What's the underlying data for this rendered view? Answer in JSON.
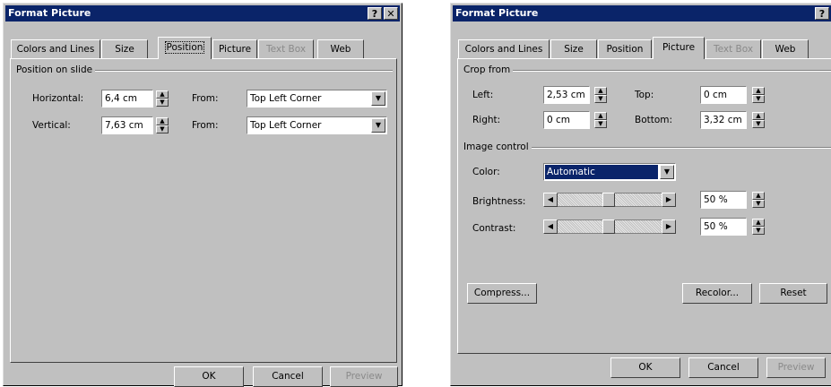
{
  "left_dialog": {
    "title": "Format Picture",
    "help_glyph": "?",
    "close_glyph": "✕",
    "tabs": [
      "Colors and Lines",
      "Size",
      "Position",
      "Picture",
      "Text Box",
      "Web"
    ],
    "active_tab": "Position",
    "group_position": "Position on slide",
    "horizontal_label": "Horizontal:",
    "horizontal_value": "6,4 cm",
    "vertical_label": "Vertical:",
    "vertical_value": "7,63 cm",
    "from_label": "From:",
    "from_horizontal_value": "Top Left Corner",
    "from_vertical_value": "Top Left Corner",
    "buttons": {
      "ok": "OK",
      "cancel": "Cancel",
      "preview": "Preview"
    }
  },
  "right_dialog": {
    "title": "Format Picture",
    "help_glyph": "?",
    "close_glyph": "✕",
    "tabs": [
      "Colors and Lines",
      "Size",
      "Position",
      "Picture",
      "Text Box",
      "Web"
    ],
    "active_tab": "Picture",
    "group_crop": "Crop from",
    "left_label": "Left:",
    "left_value": "2,53 cm",
    "right_label": "Right:",
    "right_value": "0 cm",
    "top_label": "Top:",
    "top_value": "0 cm",
    "bottom_label": "Bottom:",
    "bottom_value": "3,32 cm",
    "group_image_control": "Image control",
    "color_label": "Color:",
    "color_value": "Automatic",
    "brightness_label": "Brightness:",
    "brightness_value": "50 %",
    "brightness_level": 0.5,
    "contrast_label": "Contrast:",
    "contrast_value": "50 %",
    "contrast_level": 0.5,
    "buttons": {
      "compress": "Compress...",
      "recolor": "Recolor...",
      "reset": "Reset",
      "ok": "OK",
      "cancel": "Cancel",
      "preview": "Preview"
    }
  },
  "colors": {
    "titlebar": "#0a2469",
    "dialog_bg": "#c0c0c0",
    "selection": "#0a246a"
  },
  "icons": {
    "spin_up": "▲",
    "spin_down": "▼",
    "dropdown": "▼",
    "arrow_left": "◀",
    "arrow_right": "▶"
  }
}
